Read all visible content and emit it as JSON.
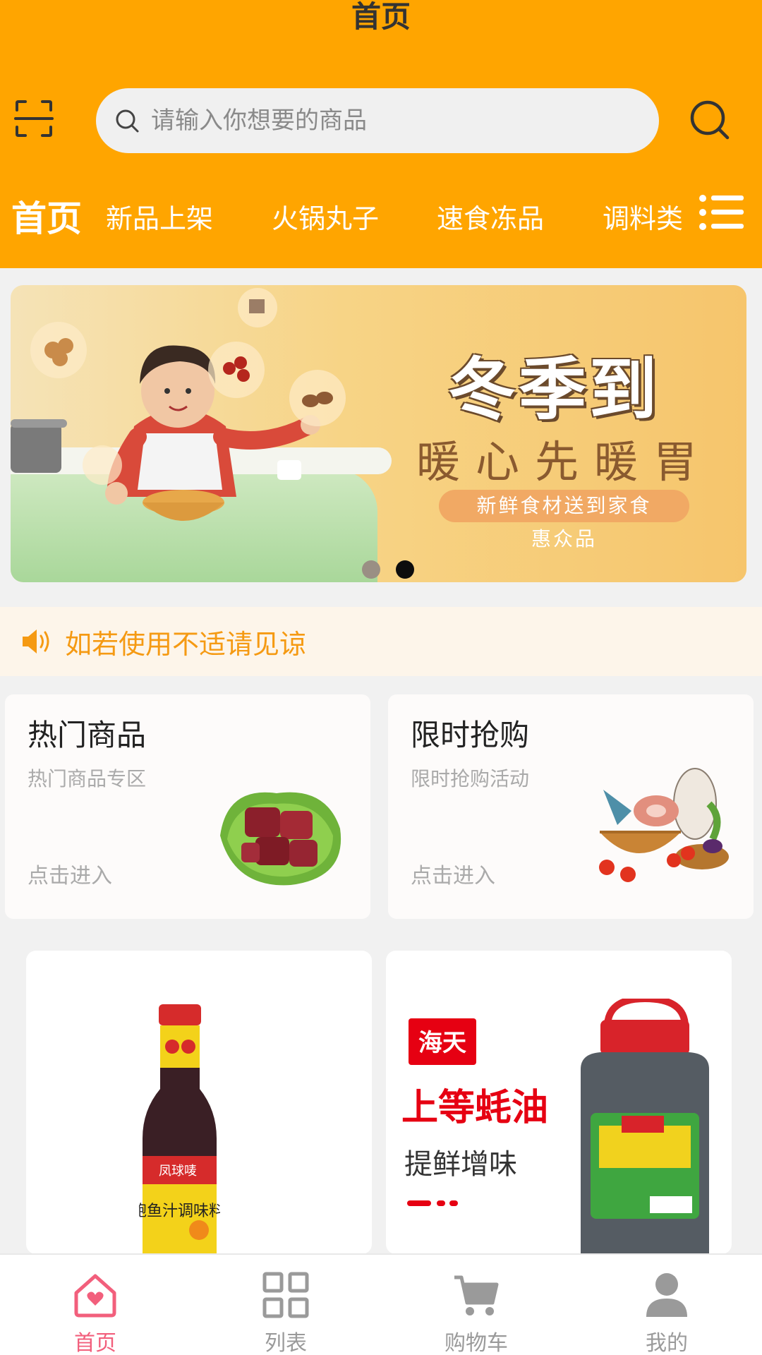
{
  "header": {
    "title": "首页",
    "search_placeholder": "请输入你想要的商品"
  },
  "tabs": [
    {
      "label": "首页",
      "active": true
    },
    {
      "label": "新品上架"
    },
    {
      "label": "火锅丸子"
    },
    {
      "label": "速食冻品"
    },
    {
      "label": "调料类"
    }
  ],
  "banner": {
    "title": "冬季到",
    "subtitle": "暖心先暖胃",
    "tagline_line1": "新鲜食材送到家食",
    "tagline_line2": "惠众品",
    "active_dot": 2,
    "dot_count": 2
  },
  "notice": {
    "text": "如若使用不适请见谅"
  },
  "promos": [
    {
      "title": "热门商品",
      "subtitle": "热门商品专区",
      "action": "点击进入"
    },
    {
      "title": "限时抢购",
      "subtitle": "限时抢购活动",
      "action": "点击进入"
    }
  ],
  "products": [
    {
      "brand": "凤球唛",
      "label": "鲍鱼汁调味料"
    },
    {
      "brand": "海天",
      "headline": "上等蚝油",
      "tagline": "提鲜增味"
    }
  ],
  "bottom_nav": [
    {
      "label": "首页",
      "icon": "home-heart-icon",
      "active": true
    },
    {
      "label": "列表",
      "icon": "grid-icon"
    },
    {
      "label": "购物车",
      "icon": "cart-icon"
    },
    {
      "label": "我的",
      "icon": "user-icon"
    }
  ],
  "colors": {
    "header_bg": "#ffa500",
    "notice_text": "#f59a13",
    "active_nav": "#f25f7c",
    "brand_red": "#e60012"
  }
}
